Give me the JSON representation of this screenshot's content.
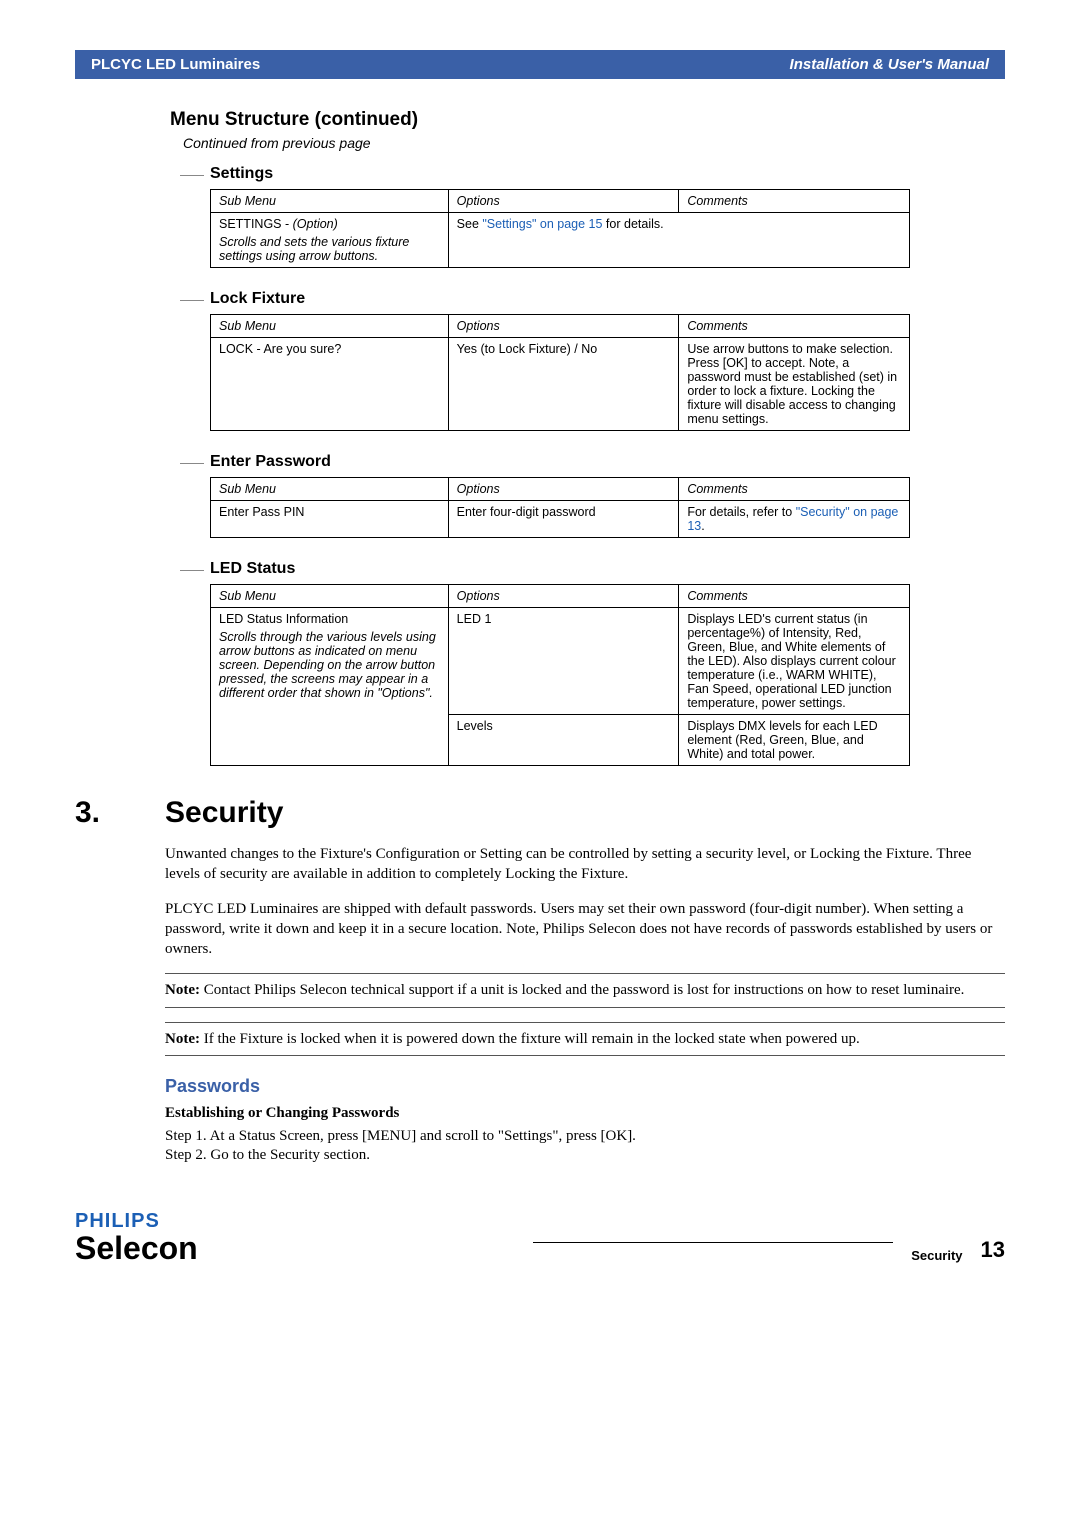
{
  "header": {
    "left": "PLCYC LED Luminaires",
    "right": "Installation & User's Manual"
  },
  "menuStructure": {
    "title": "Menu Structure (continued)",
    "continued": "Continued from previous page",
    "columns": {
      "sub": "Sub Menu",
      "opt": "Options",
      "com": "Comments"
    },
    "settings": {
      "heading": "Settings",
      "sub_prefix": "SETTINGS -",
      "sub_option_label": "(Option)",
      "sub_desc": "Scrolls and sets the various fixture settings using arrow buttons.",
      "comments_pre": "See ",
      "comments_link": "\"Settings\" on page 15",
      "comments_post": " for details."
    },
    "lock": {
      "heading": "Lock Fixture",
      "sub": "LOCK - Are you sure?",
      "opt": "Yes (to Lock Fixture) / No",
      "com": "Use arrow buttons to make selection. Press [OK] to accept. Note, a password must be established (set) in order to lock a fixture. Locking the fixture will disable access to changing menu settings."
    },
    "password": {
      "heading": "Enter Password",
      "sub": "Enter Pass PIN",
      "opt": "Enter four-digit password",
      "com_pre": "For details, refer to ",
      "com_link": "\"Security\" on page 13",
      "com_post": "."
    },
    "led": {
      "heading": "LED Status",
      "sub_title": "LED Status Information",
      "sub_desc": "Scrolls through the various levels using arrow buttons as indicated on menu screen. Depending on the arrow button pressed, the screens may appear in a different order that shown in \"Options\".",
      "row1_opt": "LED 1",
      "row1_com": "Displays LED's current status (in percentage%) of Intensity, Red, Green, Blue, and White elements of the LED). Also displays current colour temperature (i.e., WARM WHITE), Fan Speed, operational LED junction temperature, power settings.",
      "row2_opt": "Levels",
      "row2_com": "Displays DMX levels for each LED element (Red, Green, Blue, and White) and total power."
    }
  },
  "security": {
    "num": "3.",
    "title": "Security",
    "p1": "Unwanted changes to the Fixture's Configuration or Setting can be controlled by setting a security level, or Locking the Fixture. Three levels of security are available in addition to completely Locking the Fixture.",
    "p2": "PLCYC LED Luminaires are shipped with default passwords. Users may set their own password (four-digit number). When setting a password, write it down and keep it in a secure location. Note, Philips Selecon does not have records of passwords established by users or owners.",
    "note1_label": "Note:",
    "note1": "Contact Philips Selecon technical support if a unit is locked and the password is lost for instructions on how to reset luminaire.",
    "note2_label": "Note:",
    "note2": "If the Fixture is locked when it is powered down the fixture will remain in the locked state when powered up.",
    "passwords_heading": "Passwords",
    "passwords_sub": "Establishing or Changing Passwords",
    "step1": "Step  1.   At a Status Screen, press [MENU] and scroll to \"Settings\", press [OK].",
    "step2": "Step  2.   Go to the Security section."
  },
  "footer": {
    "philips": "PHILIPS",
    "selecon": "Selecon",
    "section": "Security",
    "page": "13"
  }
}
